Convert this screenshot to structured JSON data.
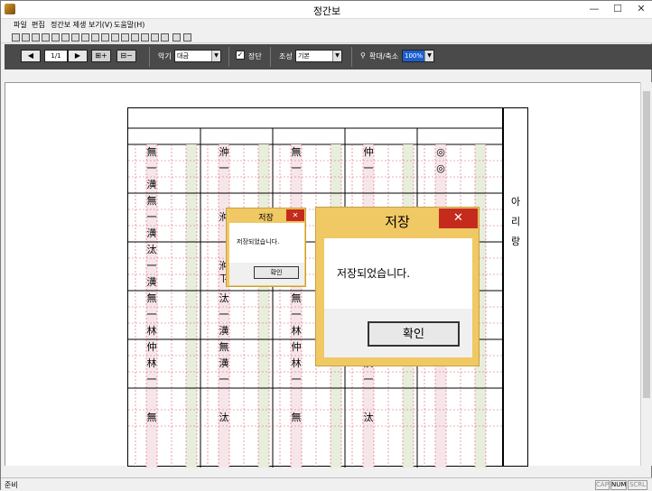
{
  "window": {
    "title": "정간보",
    "minimize": "—",
    "maximize": "☐",
    "close": "✕"
  },
  "menu": {
    "items": [
      "파일",
      "편집",
      "정간보 제생",
      "보기(V)",
      "도움말(H)"
    ]
  },
  "toolbar": {
    "page": "1/1",
    "instrument_label": "악기",
    "instrument_value": "대금",
    "checkbox_label": "장단",
    "checkbox_checked": true,
    "mode_label": "조성",
    "mode_value": "기본",
    "zoom_label": "확대/축소",
    "zoom_value": "100%"
  },
  "score": {
    "title_cells": [
      "",
      "",
      "",
      "",
      ""
    ],
    "side_title": [
      "아",
      "리",
      "랑"
    ],
    "rows": [
      [
        "無",
        "㳞",
        "無",
        "仲",
        "◎"
      ],
      [
        "一",
        "一",
        "一",
        "一",
        "◎"
      ],
      [
        "潢",
        "",
        "",
        "",
        ""
      ],
      [
        "無",
        "",
        "",
        "",
        ""
      ],
      [
        "一",
        "㳞",
        "",
        "",
        ""
      ],
      [
        "潢",
        "",
        "",
        "",
        ""
      ],
      [
        "汰",
        "",
        "汰",
        "",
        ""
      ],
      [
        "一",
        "㳞ㄗ",
        "一",
        "",
        ""
      ],
      [
        "潢",
        "",
        "潢",
        "",
        ""
      ],
      [
        "無",
        "汰",
        "無",
        "",
        ""
      ],
      [
        "一",
        "一",
        "一",
        "",
        ""
      ],
      [
        "林",
        "潢",
        "林",
        "潢",
        ""
      ],
      [
        "仲",
        "無",
        "仲",
        "無",
        ""
      ],
      [
        "林",
        "潢",
        "林",
        "潢",
        ""
      ],
      [
        "一",
        "一",
        "一",
        "一",
        ""
      ],
      [
        "",
        "",
        "",
        "",
        ""
      ],
      [
        "無",
        "汰",
        "無",
        "汰",
        ""
      ]
    ]
  },
  "dialog_small": {
    "title": "저장",
    "close": "✕",
    "message": "저장되었습니다.",
    "ok": "확인"
  },
  "dialog_large": {
    "title": "저장",
    "close": "✕",
    "message": "저장되었습니다.",
    "ok": "확인"
  },
  "status": {
    "text": "준비",
    "cap": "CAP",
    "num": "NUM",
    "scrl": "SCRL"
  }
}
